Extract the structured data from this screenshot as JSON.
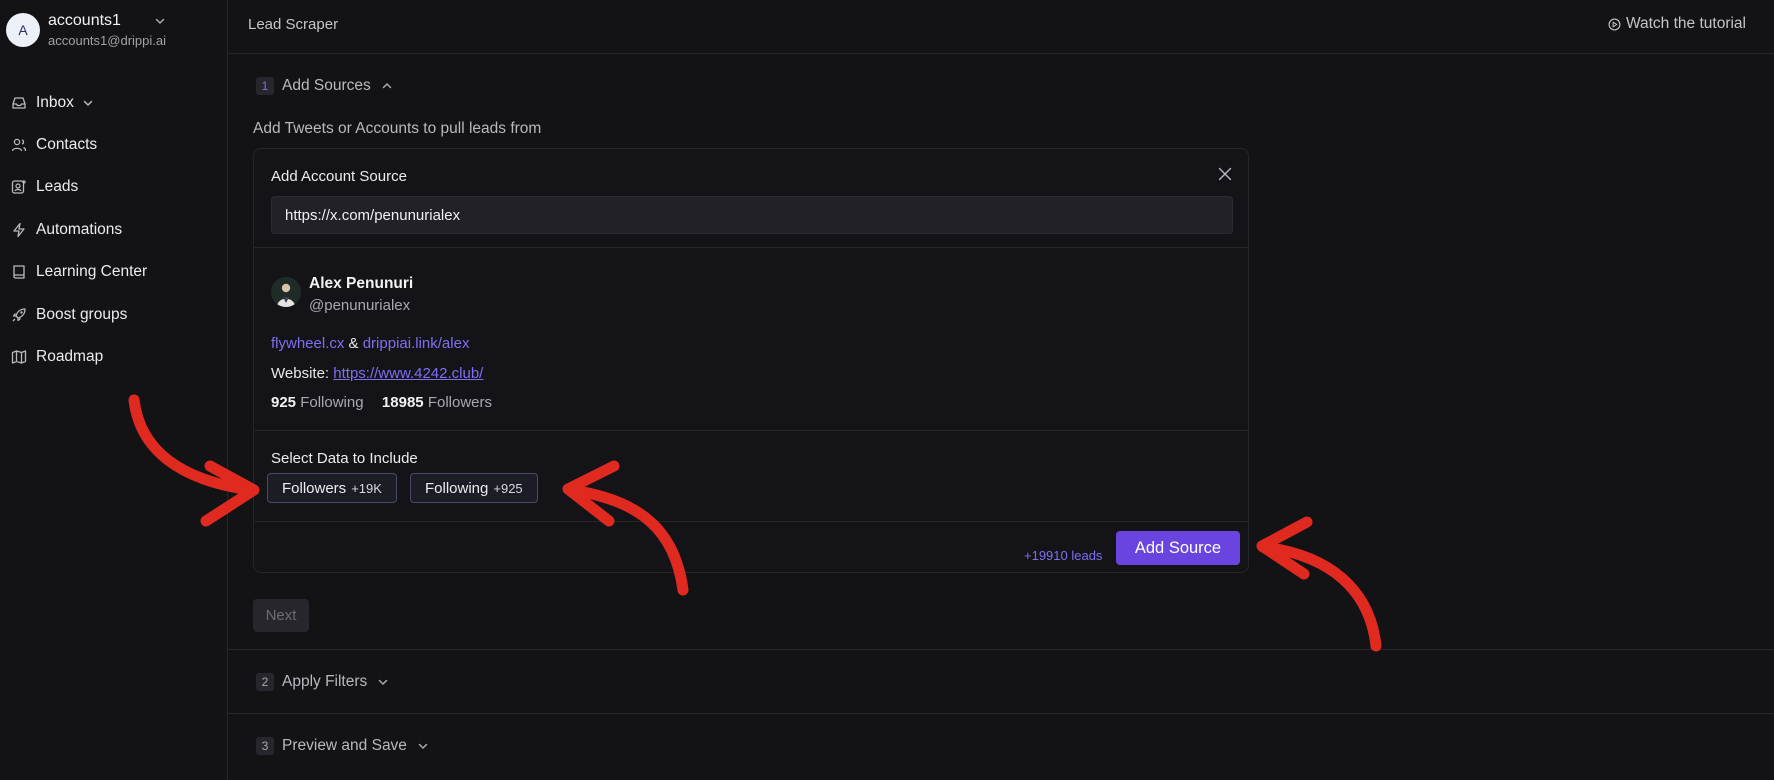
{
  "account": {
    "initial": "A",
    "name": "accounts1",
    "email": "accounts1@drippi.ai"
  },
  "nav": {
    "inbox": "Inbox",
    "contacts": "Contacts",
    "leads": "Leads",
    "automations": "Automations",
    "learning": "Learning Center",
    "boost": "Boost groups",
    "roadmap": "Roadmap"
  },
  "header": {
    "title": "Lead Scraper",
    "tutorial": "Watch the tutorial"
  },
  "steps": [
    {
      "num": "1",
      "label": "Add Sources"
    },
    {
      "num": "2",
      "label": "Apply Filters"
    },
    {
      "num": "3",
      "label": "Preview and Save"
    }
  ],
  "sources": {
    "description": "Add Tweets or Accounts to pull leads from",
    "card_title": "Add Account Source",
    "url_value": "https://x.com/penunurialex"
  },
  "profile": {
    "name": "Alex Penunuri",
    "handle": "@penunurialex",
    "bio_link1": "flywheel.cx",
    "bio_amp": "&",
    "bio_link2": "drippiai.link/alex",
    "website_label": "Website:",
    "website_url": "https://www.4242.club/",
    "following_count": "925",
    "following_label": "Following",
    "followers_count": "18985",
    "followers_label": "Followers"
  },
  "select": {
    "label": "Select Data to Include",
    "followers_label": "Followers",
    "followers_count": "+19K",
    "following_label": "Following",
    "following_count": "+925"
  },
  "footer": {
    "leads": "+19910 leads",
    "add_button": "Add Source",
    "next_button": "Next"
  },
  "colors": {
    "accent": "#6a44de",
    "link": "#7e6ff2",
    "annotation": "#e02a20",
    "background": "#131316"
  },
  "icons": [
    "inbox-icon",
    "contacts-icon",
    "leads-icon",
    "automations-icon",
    "learning-icon",
    "boost-icon",
    "roadmap-icon",
    "play-circle-icon",
    "close-icon",
    "chevron-down-icon",
    "chevron-up-icon"
  ]
}
